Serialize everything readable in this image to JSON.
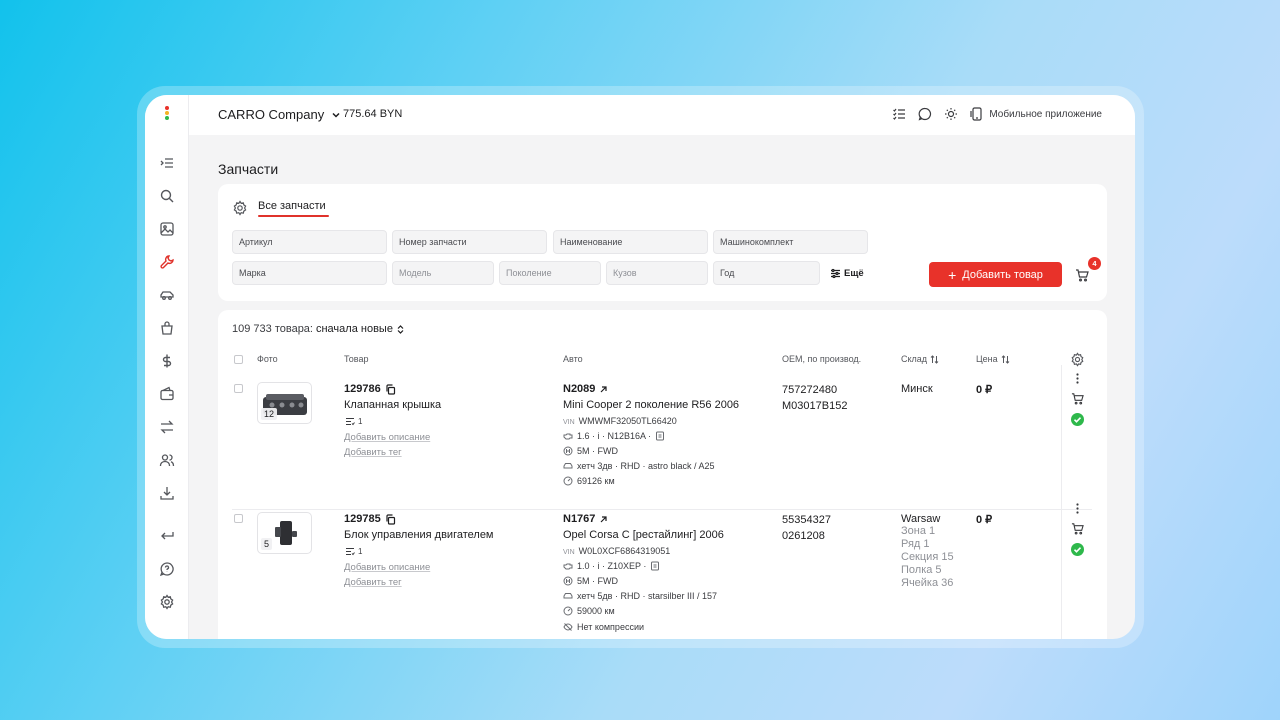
{
  "app": {
    "logo": "app-logo",
    "colors": {
      "accent": "#e8322a",
      "ok": "#2eb84b"
    }
  },
  "sidebar": {
    "items": [
      {
        "name": "collapse-icon"
      },
      {
        "name": "search-icon"
      },
      {
        "name": "image-icon"
      },
      {
        "name": "wrench-icon",
        "active": true
      },
      {
        "name": "car-icon"
      },
      {
        "name": "bag-icon"
      },
      {
        "name": "dollar-icon"
      },
      {
        "name": "wallet-icon"
      },
      {
        "name": "swap-icon"
      },
      {
        "name": "users-icon"
      },
      {
        "name": "download-icon"
      },
      {
        "name": "logout-icon"
      },
      {
        "name": "help-icon"
      },
      {
        "name": "settings-icon"
      }
    ]
  },
  "topbar": {
    "company": "CARRO Company",
    "balance": "775.64 BYN",
    "mobile_app": "Мобильное приложение"
  },
  "page": {
    "title": "Запчасти"
  },
  "filters": {
    "tab": "Все запчасти",
    "article": "Артикул",
    "part_number": "Номер запчасти",
    "name": "Наименование",
    "car_kit": "Машинокомплект",
    "brand": "Марка",
    "model": "Модель",
    "generation": "Поколение",
    "body": "Кузов",
    "year": "Год",
    "more": "Ещё",
    "add_button": "Добавить товар",
    "cart_count": "4"
  },
  "results": {
    "count_text": "109 733 товара:",
    "sort": "сначала новые",
    "columns": {
      "photo": "Фото",
      "item": "Товар",
      "car": "Авто",
      "oem": "OEM, по производ.",
      "warehouse": "Склад",
      "price": "Цена"
    },
    "rows": [
      {
        "photo_count": "12",
        "id": "129786",
        "name": "Клапанная крышка",
        "chip": "1",
        "add_description": "Добавить описание",
        "add_tag": "Добавить тег",
        "car_id": "N2089",
        "car_name": "Mini Cooper 2 поколение R56 2006",
        "vin_label": "VIN",
        "vin": "WMWMF32050TL66420",
        "engine": "1.6 · i · N12B16A ·",
        "gearbox": "5M · FWD",
        "body": "хетч 3дв · RHD · astro black / A25",
        "mileage": "69126 км",
        "oem": [
          "757272480",
          "M03017B152"
        ],
        "warehouse": "Минск",
        "warehouse_sub": [],
        "price": "0 ₽"
      },
      {
        "photo_count": "5",
        "id": "129785",
        "name": "Блок управления двигателем",
        "chip": "1",
        "add_description": "Добавить описание",
        "add_tag": "Добавить тег",
        "car_id": "N1767",
        "car_name": "Opel Corsa C [рестайлинг] 2006",
        "vin_label": "VIN",
        "vin": "W0L0XCF6864319051",
        "engine": "1.0 · i · Z10XEP ·",
        "gearbox": "5M · FWD",
        "body": "хетч 5дв · RHD · starsilber III / 157",
        "mileage": "59000 км",
        "note": "Нет компрессии",
        "oem": [
          "55354327",
          "0261208"
        ],
        "warehouse": "Warsaw",
        "warehouse_sub": [
          "Зона 1",
          "Ряд 1",
          "Секция 15",
          "Полка 5",
          "Ячейка 36"
        ],
        "price": "0 ₽"
      }
    ]
  }
}
